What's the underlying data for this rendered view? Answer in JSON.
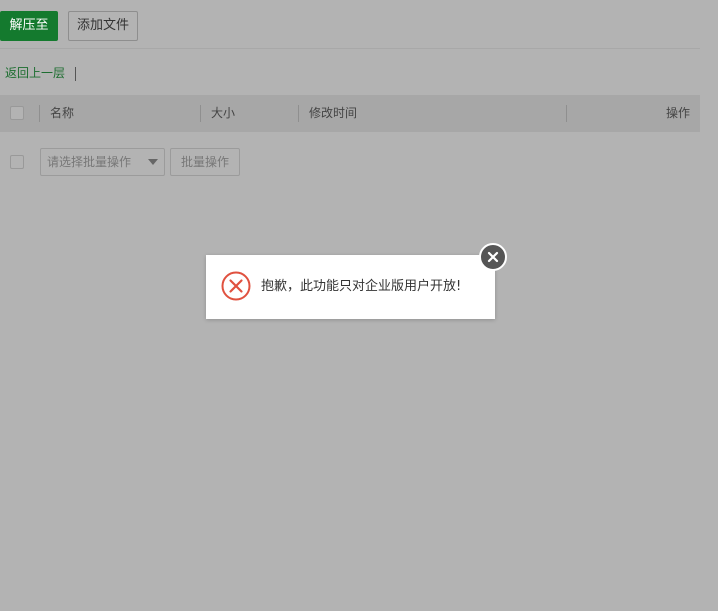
{
  "toolbar": {
    "extract_label": "解压至",
    "add_file_label": "添加文件"
  },
  "breadcrumb": {
    "back_label": "返回上一层"
  },
  "table": {
    "columns": [
      "名称",
      "大小",
      "修改时间",
      "操作"
    ]
  },
  "batch": {
    "select_placeholder": "请选择批量操作",
    "button_label": "批量操作"
  },
  "dialog": {
    "message": "抱歉，此功能只对企业版用户开放!",
    "icon": "error-circle-icon"
  },
  "colors": {
    "primary": "#147a2e",
    "link": "#1c6d2f",
    "overlay": "#b3b3b3",
    "error": "#e0513f"
  }
}
